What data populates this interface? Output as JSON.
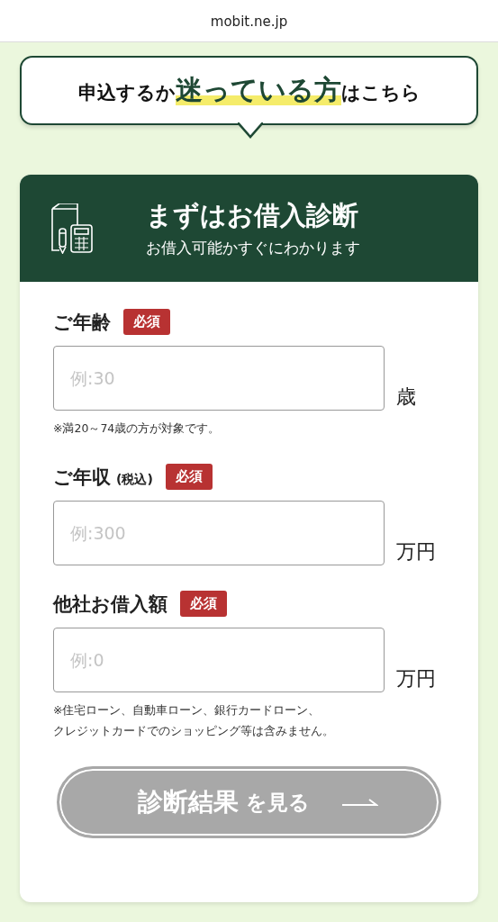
{
  "address_bar": {
    "url": "mobit.ne.jp"
  },
  "banner": {
    "lead": "申込するか",
    "highlight": "迷っている方",
    "tail": "はこちら"
  },
  "card": {
    "title": "まずはお借入診断",
    "subtitle": "お借入可能かすぐにわかります",
    "fields": [
      {
        "label": "ご年齢",
        "badge": "必須",
        "placeholder": "例:30",
        "unit": "歳",
        "note_lines": [
          "※満20～74歳の方が対象です。"
        ]
      },
      {
        "label": "ご年収",
        "suffix": "(税込)",
        "badge": "必須",
        "placeholder": "例:300",
        "unit": "万円"
      },
      {
        "label": "他社お借入額",
        "badge": "必須",
        "placeholder": "例:0",
        "unit": "万円",
        "note_lines": [
          "※住宅ローン、自動車ローン、銀行カードローン、",
          "クレジットカードでのショッピング等は含みません。"
        ]
      }
    ],
    "button": {
      "main": "診断結果",
      "sub": "を見る",
      "disabled": true
    }
  }
}
